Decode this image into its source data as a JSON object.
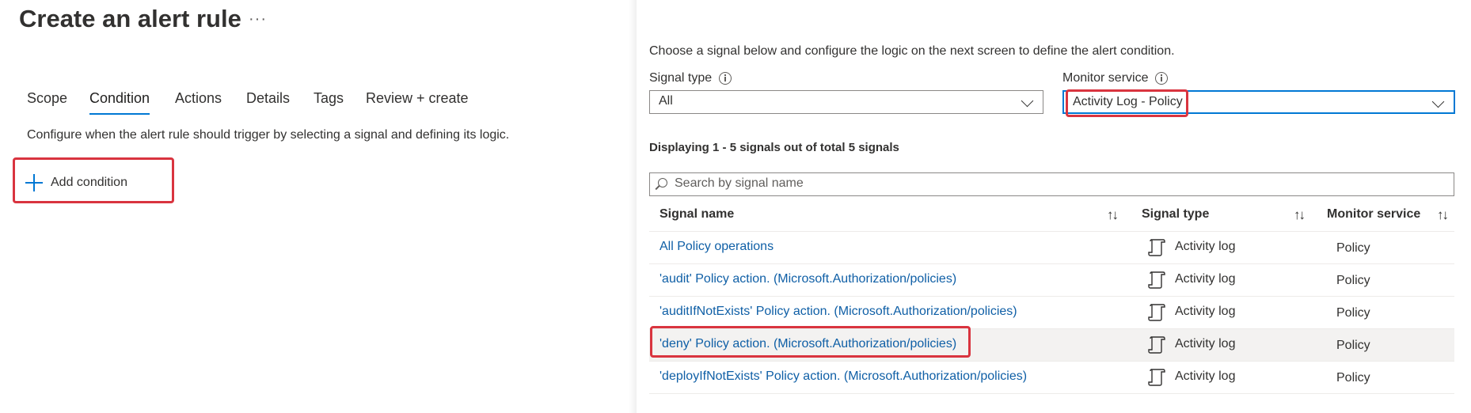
{
  "left": {
    "title": "Create an alert rule",
    "more": "···",
    "tabs": [
      {
        "label": "Scope"
      },
      {
        "label": "Condition"
      },
      {
        "label": "Actions"
      },
      {
        "label": "Details"
      },
      {
        "label": "Tags"
      },
      {
        "label": "Review + create"
      }
    ],
    "active_tab": "Condition",
    "description": "Configure when the alert rule should trigger by selecting a signal and defining its logic.",
    "add_condition_label": "Add condition"
  },
  "right": {
    "intro": "Choose a signal below and configure the logic on the next screen to define the alert condition.",
    "signal_type": {
      "label": "Signal type",
      "value": "All"
    },
    "monitor_service": {
      "label": "Monitor service",
      "value": "Activity Log - Policy"
    },
    "displaying": "Displaying 1 - 5 signals out of total 5 signals",
    "search_placeholder": "Search by signal name",
    "columns": [
      "Signal name",
      "Signal type",
      "Monitor service"
    ],
    "sort_glyph": "↑↓",
    "rows": [
      {
        "name": "All Policy operations",
        "type": "Activity log",
        "service": "Policy"
      },
      {
        "name": "'audit' Policy action. (Microsoft.Authorization/policies)",
        "type": "Activity log",
        "service": "Policy"
      },
      {
        "name": "'auditIfNotExists' Policy action. (Microsoft.Authorization/policies)",
        "type": "Activity log",
        "service": "Policy"
      },
      {
        "name": "'deny' Policy action. (Microsoft.Authorization/policies)",
        "type": "Activity log",
        "service": "Policy"
      },
      {
        "name": "'deployIfNotExists' Policy action. (Microsoft.Authorization/policies)",
        "type": "Activity log",
        "service": "Policy"
      }
    ],
    "selected_row": 3
  },
  "colors": {
    "accent": "#0078d4",
    "link": "#0f5fa6",
    "highlight": "#d9343f"
  },
  "icons": {
    "add": "plus-icon",
    "info": "info-icon",
    "search": "search-icon",
    "row_type": "activity-log-icon",
    "sort": "sort-icon",
    "dropdown": "chevron-down-icon"
  }
}
